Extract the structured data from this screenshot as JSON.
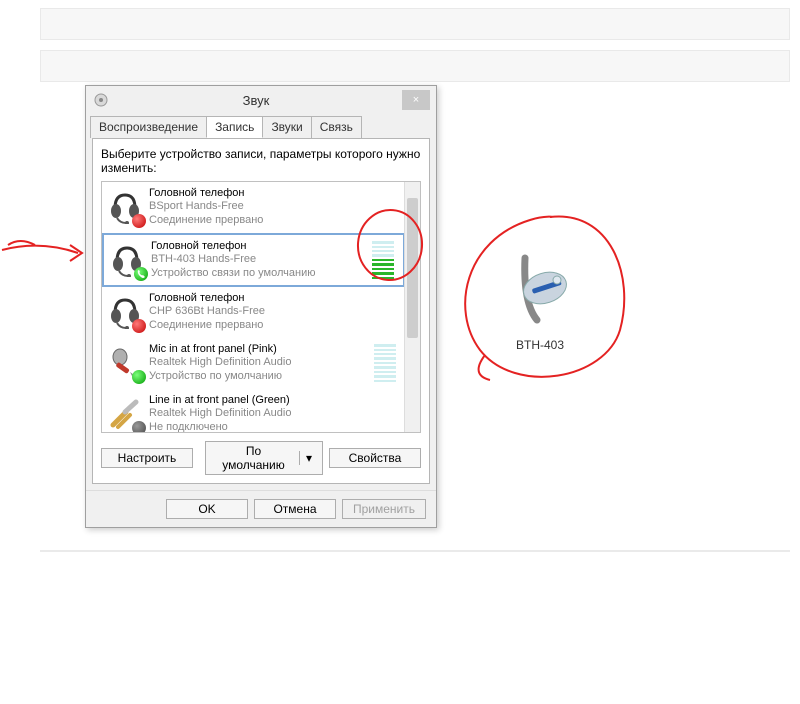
{
  "dialog": {
    "title": "Звук",
    "close": "×",
    "tabs": [
      "Воспроизведение",
      "Запись",
      "Звуки",
      "Связь"
    ],
    "active_tab_index": 1,
    "instruction": "Выберите устройство записи, параметры которого нужно изменить:",
    "devices": [
      {
        "name": "Головной телефон",
        "sub": "BSport Hands-Free",
        "status": "Соединение прервано",
        "meter_on": 0,
        "meter_total": 0,
        "selected": false,
        "badge": "red",
        "icon": "headset"
      },
      {
        "name": "Головной телефон",
        "sub": "BTH-403 Hands-Free",
        "status": "Устройство связи по умолчанию",
        "meter_on": 5,
        "meter_total": 9,
        "selected": true,
        "badge": "phone",
        "icon": "headset"
      },
      {
        "name": "Головной телефон",
        "sub": "CHP 636Bt Hands-Free",
        "status": "Соединение прервано",
        "meter_on": 0,
        "meter_total": 0,
        "selected": false,
        "badge": "red",
        "icon": "headset"
      },
      {
        "name": "Mic in at front panel (Pink)",
        "sub": "Realtek High Definition Audio",
        "status": "Устройство по умолчанию",
        "meter_on": 0,
        "meter_total": 9,
        "selected": false,
        "badge": "green",
        "icon": "mic"
      },
      {
        "name": "Line in at front panel (Green)",
        "sub": "Realtek High Definition Audio",
        "status": "Не подключено",
        "meter_on": 0,
        "meter_total": 0,
        "selected": false,
        "badge": "dark",
        "icon": "jack"
      }
    ],
    "btn_configure": "Настроить",
    "btn_default": "По умолчанию",
    "btn_properties": "Свойства",
    "btn_ok": "OK",
    "btn_cancel": "Отмена",
    "btn_apply": "Применить"
  },
  "side": {
    "label": "BTH-403"
  }
}
